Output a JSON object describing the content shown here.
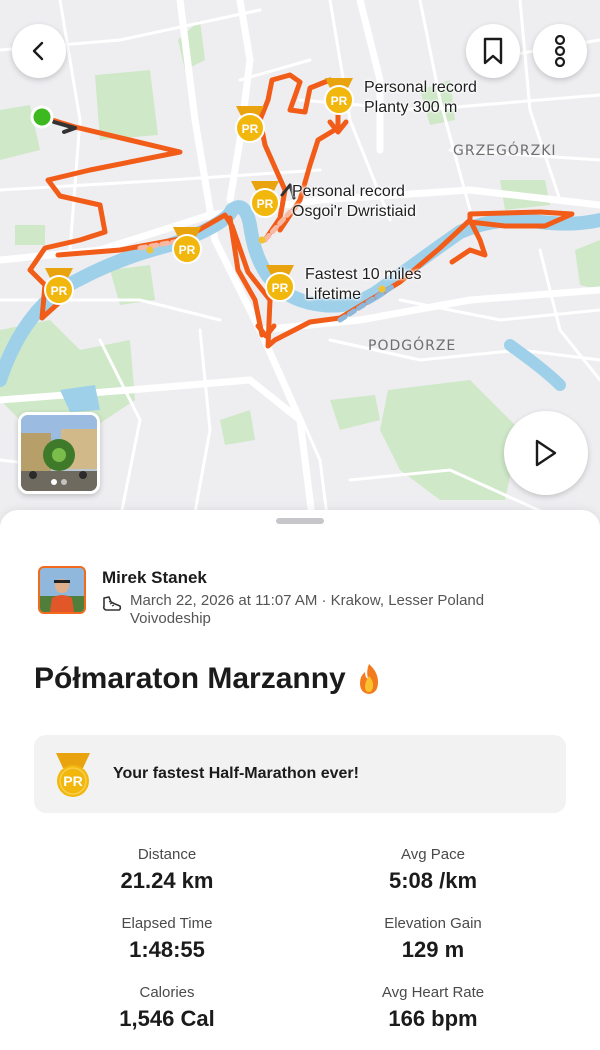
{
  "map": {
    "district_labels": [
      "GRZEGÓRZKI",
      "PODGÓRZE"
    ],
    "annotations": [
      {
        "line1": "Personal record",
        "line2": "Planty 300 m"
      },
      {
        "line1": "Personal record",
        "line2": "Osgoi'r Dwristiaid"
      },
      {
        "line1": "Fastest 10 miles",
        "line2": "Lifetime"
      }
    ],
    "medal_text": "PR",
    "route_color": "#f25c19",
    "start_color": "#3db81f",
    "photo_count": 2,
    "icons": {
      "back": "chevron-left-icon",
      "bookmark": "bookmark-icon",
      "more": "more-vertical-icon",
      "play": "play-icon"
    }
  },
  "activity": {
    "athlete_name": "Mirek Stanek",
    "date_location": "March 22, 2026 at 11:07 AM · Krakow, Lesser Poland Voivodeship",
    "sport_icon": "running-shoe-icon",
    "title": "Półmaraton Marzanny",
    "title_emoji": "flame-icon",
    "achievement": {
      "medal_text": "PR",
      "text": "Your fastest Half-Marathon ever!"
    }
  },
  "stats": [
    {
      "label": "Distance",
      "value": "21.24 km"
    },
    {
      "label": "Avg Pace",
      "value": "5:08 /km"
    },
    {
      "label": "Elapsed Time",
      "value": "1:48:55"
    },
    {
      "label": "Elevation Gain",
      "value": "129 m"
    },
    {
      "label": "Calories",
      "value": "1,546 Cal"
    },
    {
      "label": "Avg Heart Rate",
      "value": "166 bpm"
    }
  ],
  "colors": {
    "accent": "#f26a1b",
    "medal_gold": "#f2b70d",
    "banner_bg": "#f2f2f2"
  }
}
